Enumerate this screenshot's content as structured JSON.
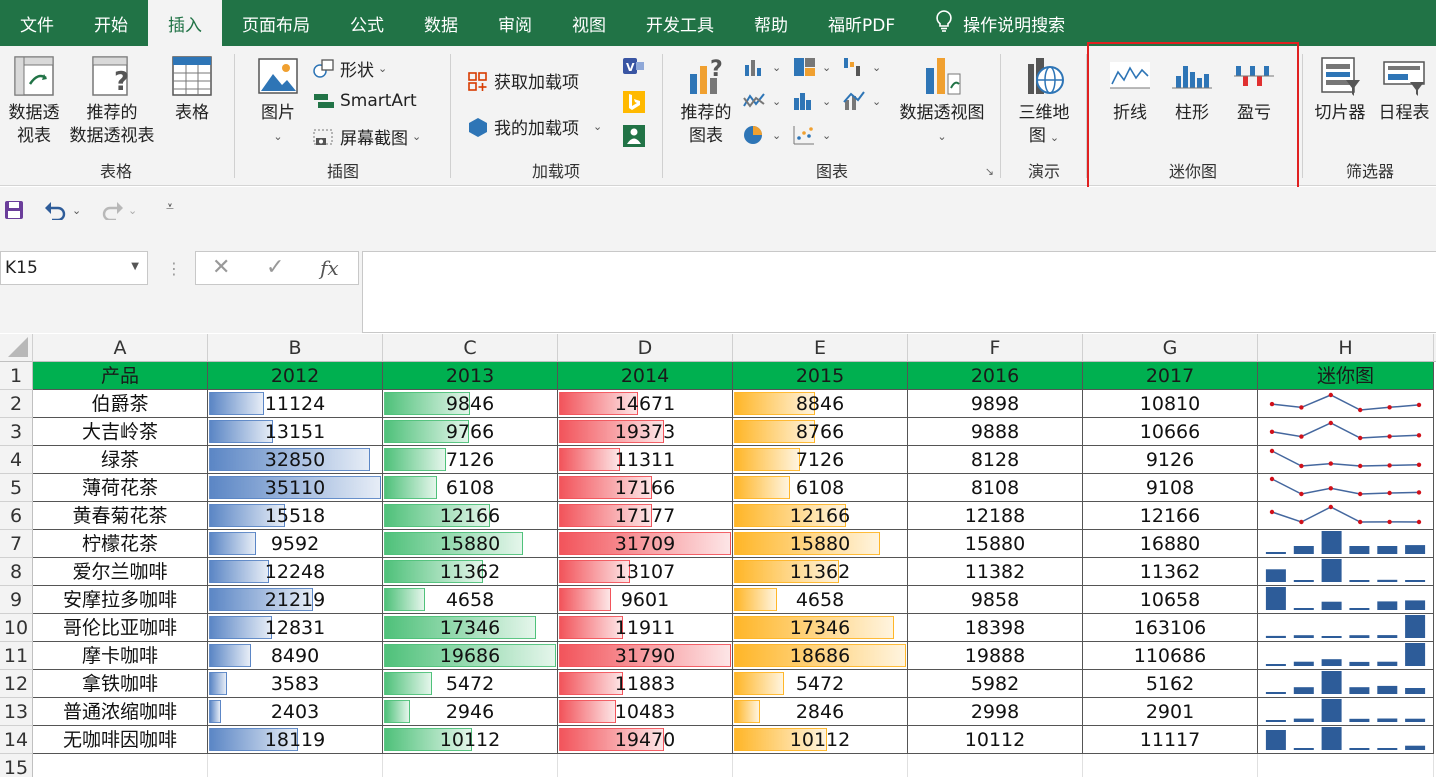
{
  "tabs": [
    "文件",
    "开始",
    "插入",
    "页面布局",
    "公式",
    "数据",
    "审阅",
    "视图",
    "开发工具",
    "帮助",
    "福昕PDF",
    "操作说明搜索"
  ],
  "active_tab": "插入",
  "ribbon": {
    "tables": {
      "label": "表格",
      "pivot": "数据透\n视表",
      "recommended_pivot": "推荐的\n数据透视表",
      "table": "表格"
    },
    "illustrations": {
      "label": "插图",
      "pictures": "图片",
      "shapes": "形状",
      "smartart": "SmartArt",
      "screenshot": "屏幕截图"
    },
    "addins": {
      "label": "加载项",
      "get": "获取加载项",
      "my": "我的加载项"
    },
    "charts": {
      "label": "图表",
      "recommended": "推荐的\n图表",
      "pivotchart": "数据透视图"
    },
    "tours": {
      "label": "演示",
      "map3d": "三维地\n图"
    },
    "sparklines": {
      "label": "迷你图",
      "line": "折线",
      "column": "柱形",
      "winloss": "盈亏"
    },
    "filters": {
      "label": "筛选器",
      "slicer": "切片器",
      "timeline": "日程表"
    }
  },
  "name_box": "K15",
  "formula_fx": "fx",
  "formula_value": "",
  "columns": [
    "A",
    "B",
    "C",
    "D",
    "E",
    "F",
    "G",
    "H"
  ],
  "header_row": [
    "产品",
    "2012",
    "2013",
    "2014",
    "2015",
    "2016",
    "2017",
    "迷你图"
  ],
  "rows": [
    [
      "伯爵茶",
      11124,
      9846,
      14671,
      8846,
      9898,
      10810
    ],
    [
      "大吉岭茶",
      13151,
      9766,
      19373,
      8766,
      9888,
      10666
    ],
    [
      "绿茶",
      32850,
      7126,
      11311,
      7126,
      8128,
      9126
    ],
    [
      "薄荷花茶",
      35110,
      6108,
      17166,
      6108,
      8108,
      9108
    ],
    [
      "黄春菊花茶",
      15518,
      12166,
      17177,
      12166,
      12188,
      12166
    ],
    [
      "柠檬花茶",
      9592,
      15880,
      31709,
      15880,
      15880,
      16880
    ],
    [
      "爱尔兰咖啡",
      12248,
      11362,
      13107,
      11362,
      11382,
      11362
    ],
    [
      "安摩拉多咖啡",
      21219,
      4658,
      9601,
      4658,
      9858,
      10658
    ],
    [
      "哥伦比亚咖啡",
      12831,
      17346,
      11911,
      17346,
      18398,
      163106
    ],
    [
      "摩卡咖啡",
      8490,
      19686,
      31790,
      18686,
      19888,
      110686
    ],
    [
      "拿铁咖啡",
      3583,
      5472,
      11883,
      5472,
      5982,
      5162
    ],
    [
      "普通浓缩咖啡",
      2403,
      2946,
      10483,
      2846,
      2998,
      2901
    ],
    [
      "无咖啡因咖啡",
      18119,
      10112,
      19470,
      10112,
      10112,
      11117
    ]
  ],
  "sparkline_types": [
    "line",
    "line",
    "line",
    "line",
    "line",
    "column",
    "column",
    "column",
    "column",
    "column",
    "column",
    "column",
    "column"
  ],
  "databar_colors": {
    "B": "#5b86c5",
    "C": "#4fc17a",
    "D": "#f2545b",
    "E": "#ffb628"
  },
  "sparkline_colors": {
    "line": "#44679e",
    "marker": "#d0101a",
    "column": "#2d5c99"
  },
  "selected_cell": "K15"
}
